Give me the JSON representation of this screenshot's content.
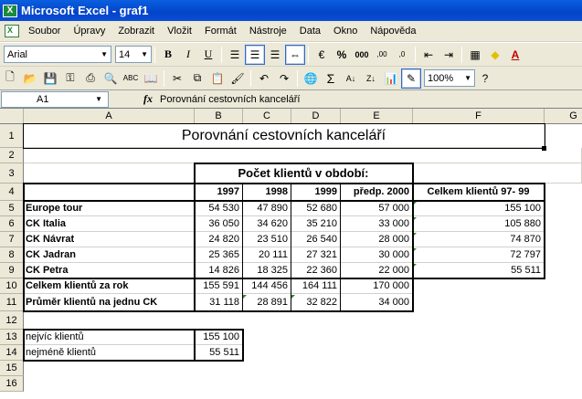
{
  "window": {
    "title": "Microsoft Excel - graf1"
  },
  "menu": [
    "Soubor",
    "Úpravy",
    "Zobrazit",
    "Vložit",
    "Formát",
    "Nástroje",
    "Data",
    "Okno",
    "Nápověda"
  ],
  "format_toolbar": {
    "font": "Arial",
    "size": "14"
  },
  "standard_toolbar": {
    "zoom": "100%"
  },
  "formula_bar": {
    "cell_ref": "A1",
    "fx": "fx",
    "content": "Porovnání cestovních kanceláří"
  },
  "columns": [
    "A",
    "B",
    "C",
    "D",
    "E",
    "F",
    "G"
  ],
  "rows": [
    "1",
    "2",
    "3",
    "4",
    "5",
    "6",
    "7",
    "8",
    "9",
    "10",
    "11",
    "12",
    "13",
    "14",
    "15",
    "16"
  ],
  "sheet": {
    "title": "Porovnání cestovních kanceláří",
    "period_header": "Počet klientů v období:",
    "year_headers": [
      "1997",
      "1998",
      "1999",
      "předp. 2000"
    ],
    "total_header": "Celkem klientů 97- 99",
    "agencies": [
      {
        "name": "Europe tour",
        "values": [
          "54 530",
          "47 890",
          "52 680",
          "57 000"
        ],
        "total": "155 100"
      },
      {
        "name": "CK Italia",
        "values": [
          "36 050",
          "34 620",
          "35 210",
          "33 000"
        ],
        "total": "105 880"
      },
      {
        "name": "CK Návrat",
        "values": [
          "24 820",
          "23 510",
          "26 540",
          "28 000"
        ],
        "total": "74 870"
      },
      {
        "name": "CK Jadran",
        "values": [
          "25 365",
          "20 111",
          "27 321",
          "30 000"
        ],
        "total": "72 797"
      },
      {
        "name": "CK Petra",
        "values": [
          "14 826",
          "18 325",
          "22 360",
          "22 000"
        ],
        "total": "55 511"
      }
    ],
    "sum_row": {
      "label": "Celkem klientů za rok",
      "values": [
        "155 591",
        "144 456",
        "164 111",
        "170 000"
      ]
    },
    "avg_row": {
      "label": "Průměr klientů na jednu CK",
      "values": [
        "31 118",
        "28 891",
        "32 822",
        "34 000"
      ]
    },
    "max_row": {
      "label": "nejvíc klientů",
      "value": "155 100"
    },
    "min_row": {
      "label": "nejméně klientů",
      "value": "55 511"
    }
  },
  "colors": {
    "title_bar": "#0a5fe0",
    "error_indicator": "#2a8a2a",
    "chrome": "#ece9d8"
  }
}
